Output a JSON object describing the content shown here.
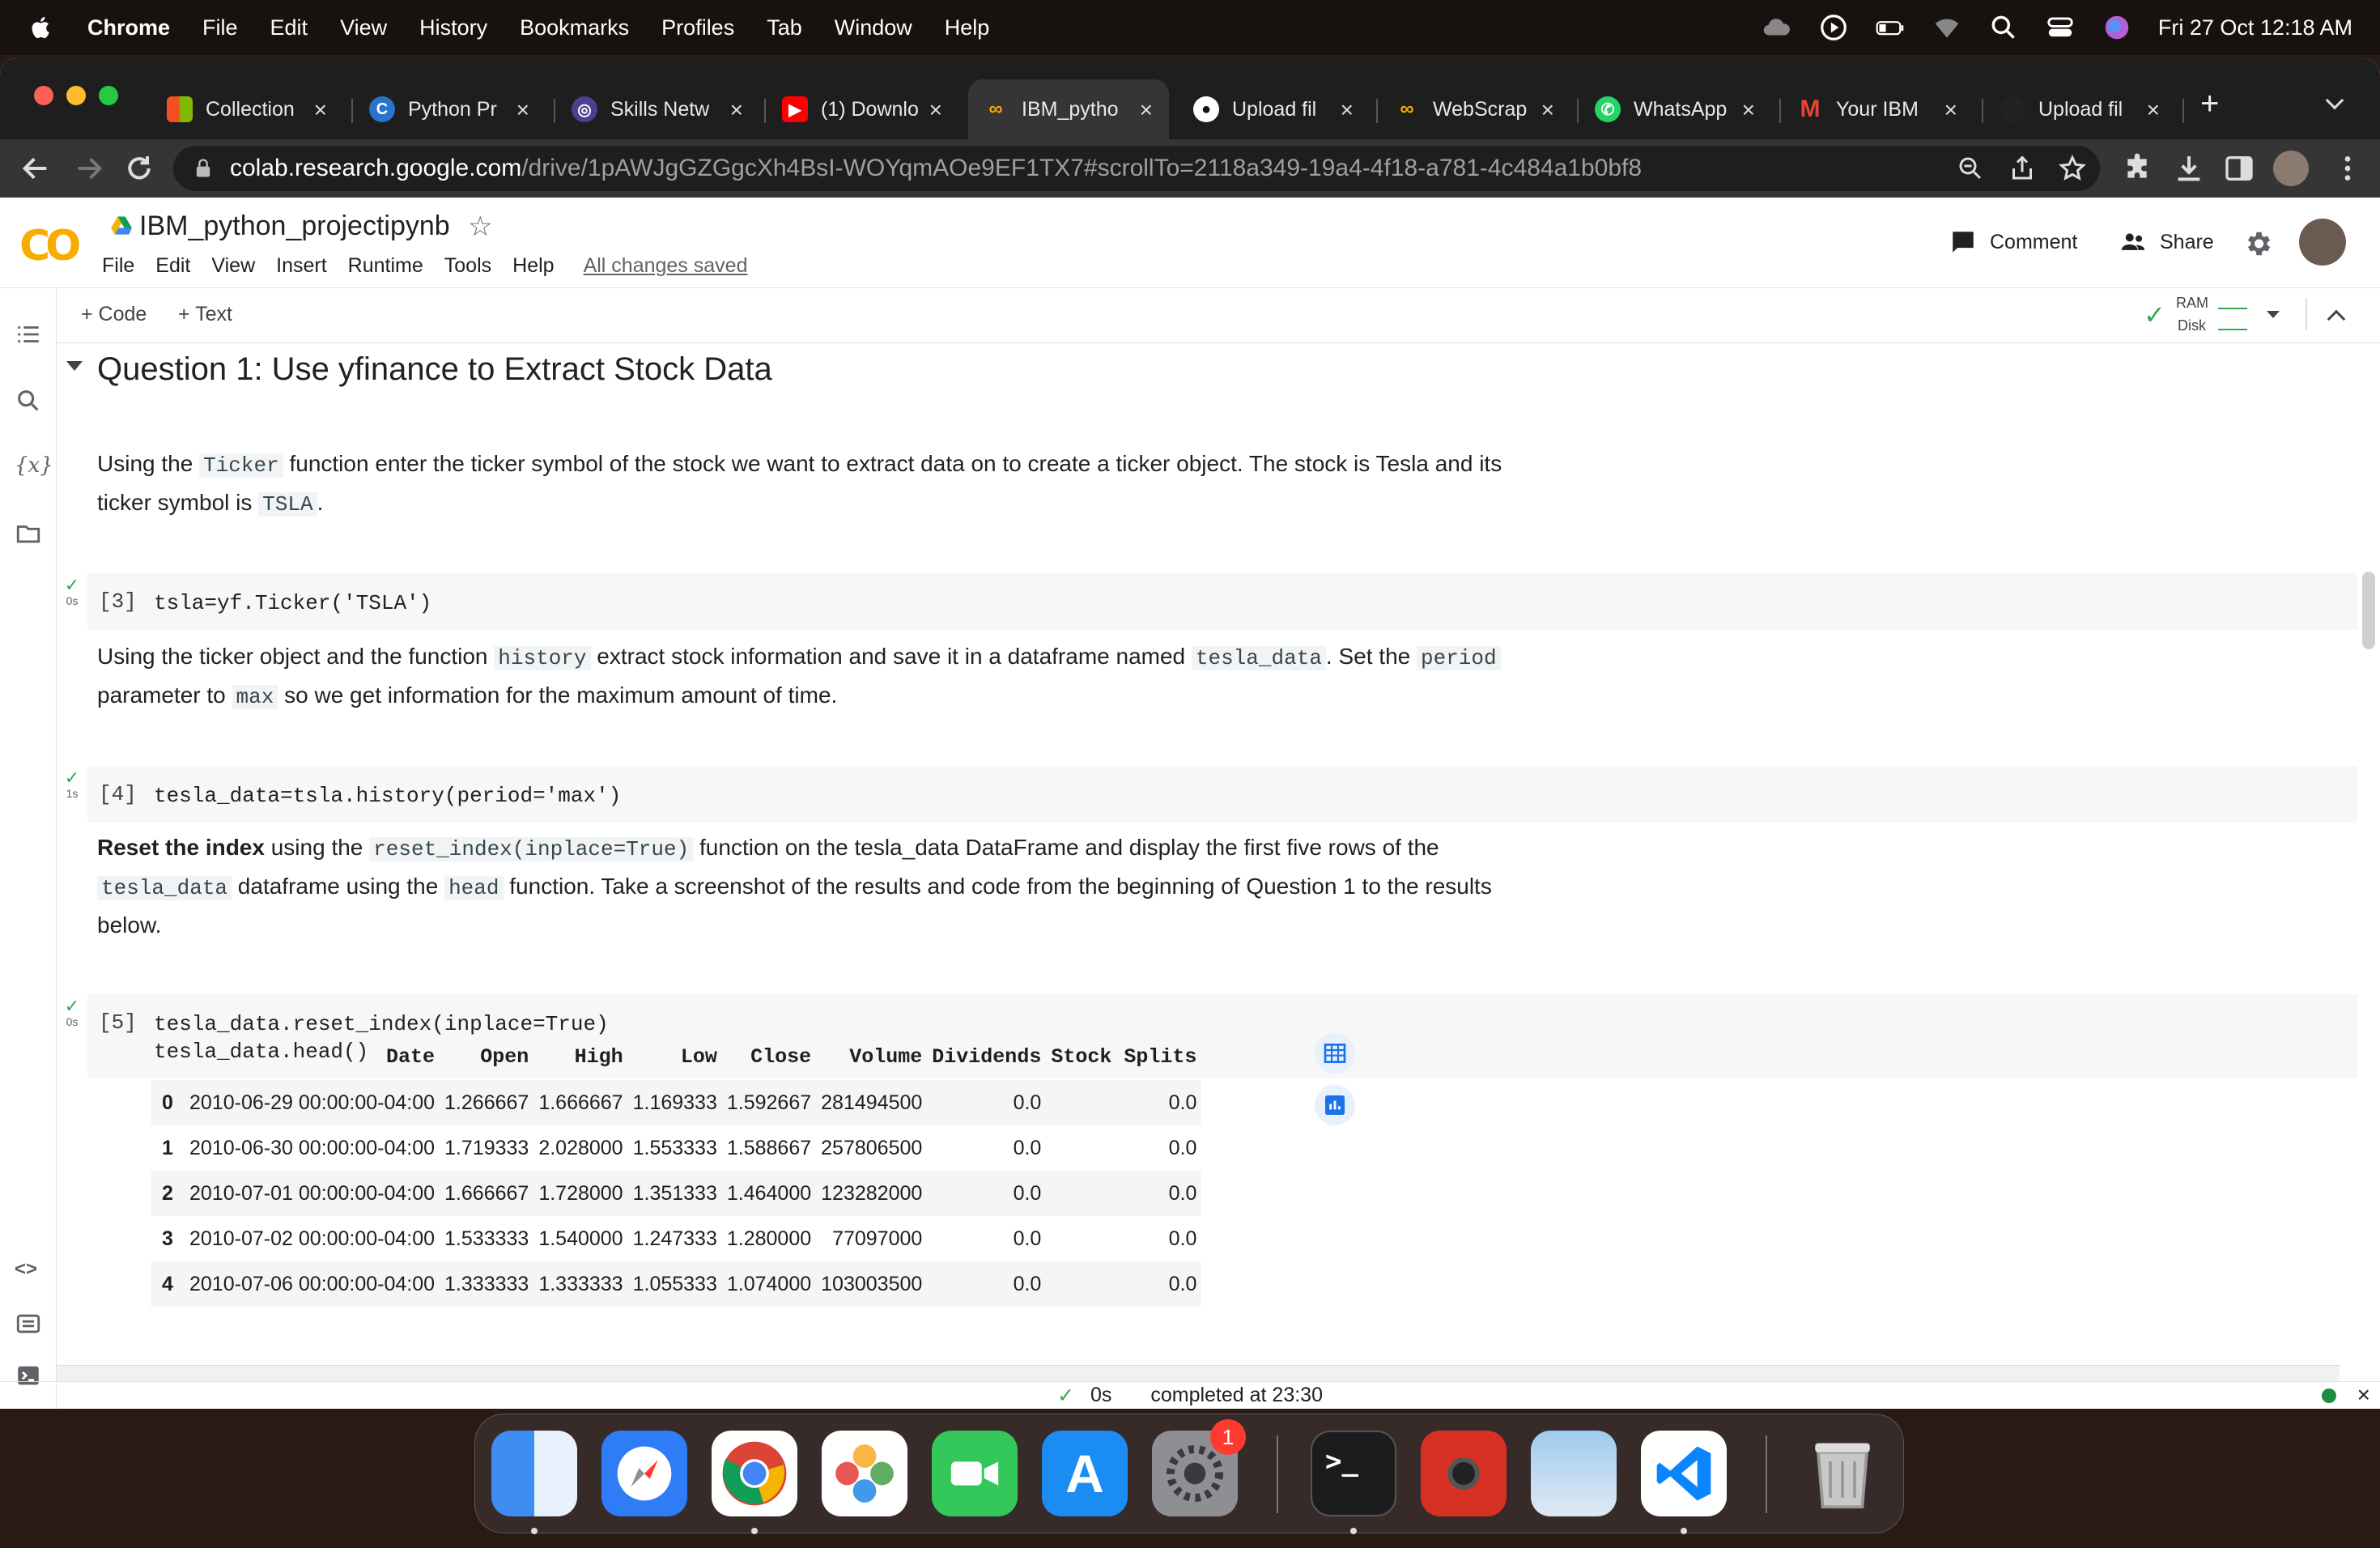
{
  "menubar": {
    "app": "Chrome",
    "items": [
      "File",
      "Edit",
      "View",
      "History",
      "Bookmarks",
      "Profiles",
      "Tab",
      "Window",
      "Help"
    ],
    "clock": "Fri 27 Oct  12:18 AM"
  },
  "browser": {
    "tabs": [
      {
        "label": "Collection",
        "icon": "grid-icon",
        "color": "#f25022"
      },
      {
        "label": "Python Pr",
        "icon": "coursera-icon",
        "color": "#2a73cc"
      },
      {
        "label": "Skills Netw",
        "icon": "skills-network-icon",
        "color": "#4b3f8f"
      },
      {
        "label": "(1) Downlo",
        "icon": "youtube-icon",
        "color": "#ff0000"
      },
      {
        "label": "IBM_pytho",
        "icon": "colab-icon",
        "color": "#f9ab00"
      },
      {
        "label": "Upload fil",
        "icon": "github-icon",
        "color": "#ffffff"
      },
      {
        "label": "WebScrap",
        "icon": "colab-icon",
        "color": "#f9ab00"
      },
      {
        "label": "WhatsApp",
        "icon": "whatsapp-icon",
        "color": "#25d366"
      },
      {
        "label": "Your IBM",
        "icon": "gmail-icon",
        "color": "#ea4335"
      },
      {
        "label": "Upload fil",
        "icon": "github-icon",
        "color": "#222222"
      }
    ],
    "url_host": "colab.research.google.com",
    "url_path": "/drive/1pAWJgGZGgcXh4BsI-WOYqmAOe9EF1TX7#scrollTo=2118a349-19a4-4f18-a781-4c484a1b0bf8"
  },
  "colab": {
    "title": "IBM_python_projectipynb",
    "menus": [
      "File",
      "Edit",
      "View",
      "Insert",
      "Runtime",
      "Tools",
      "Help"
    ],
    "saved_status": "All changes saved",
    "comment_label": "Comment",
    "share_label": "Share",
    "add_code": "+ Code",
    "add_text": "+ Text",
    "ram_label": "RAM",
    "disk_label": "Disk"
  },
  "notebook": {
    "section_title": "Question 1: Use yfinance to Extract Stock Data",
    "para1": {
      "t1": "Using the ",
      "c1": "Ticker",
      "t2": " function enter the ticker symbol of the stock we want to extract data on to create a ticker object. The stock is Tesla and its",
      "t3": "ticker symbol is ",
      "c2": "TSLA",
      "t4": "."
    },
    "cell3": {
      "prompt": "[3]",
      "code": "tsla=yf.Ticker('TSLA')",
      "time": "0s"
    },
    "para2": {
      "t1": "Using the ticker object and the function ",
      "c1": "history",
      "t2": " extract stock information and save it in a dataframe named ",
      "c2": "tesla_data",
      "t3": ". Set the ",
      "c3": "period",
      "t4": "parameter to ",
      "c4": "max",
      "t5": " so we get information for the maximum amount of time."
    },
    "cell4": {
      "prompt": "[4]",
      "code": "tesla_data=tsla.history(period='max')",
      "time": "1s"
    },
    "para3": {
      "b1": "Reset the index",
      "t1": " using the ",
      "c1": "reset_index(inplace=True)",
      "t2": " function on the tesla_data DataFrame and display the first five rows of the",
      "c2": "tesla_data",
      "t3": " dataframe using the ",
      "c3": "head",
      "t4": " function. Take a screenshot of the results and code from the beginning of Question 1 to the results",
      "t5": "below."
    },
    "cell5": {
      "prompt": "[5]",
      "line1": "tesla_data.reset_index(inplace=True)",
      "line2": "tesla_data.head()",
      "time": "0s"
    },
    "dataframe": {
      "columns": [
        "Date",
        "Open",
        "High",
        "Low",
        "Close",
        "Volume",
        "Dividends",
        "Stock Splits"
      ],
      "rows": [
        {
          "index": "0",
          "cells": [
            "2010-06-29 00:00:00-04:00",
            "1.266667",
            "1.666667",
            "1.169333",
            "1.592667",
            "281494500",
            "0.0",
            "0.0"
          ]
        },
        {
          "index": "1",
          "cells": [
            "2010-06-30 00:00:00-04:00",
            "1.719333",
            "2.028000",
            "1.553333",
            "1.588667",
            "257806500",
            "0.0",
            "0.0"
          ]
        },
        {
          "index": "2",
          "cells": [
            "2010-07-01 00:00:00-04:00",
            "1.666667",
            "1.728000",
            "1.351333",
            "1.464000",
            "123282000",
            "0.0",
            "0.0"
          ]
        },
        {
          "index": "3",
          "cells": [
            "2010-07-02 00:00:00-04:00",
            "1.533333",
            "1.540000",
            "1.247333",
            "1.280000",
            "77097000",
            "0.0",
            "0.0"
          ]
        },
        {
          "index": "4",
          "cells": [
            "2010-07-06 00:00:00-04:00",
            "1.333333",
            "1.333333",
            "1.055333",
            "1.074000",
            "103003500",
            "0.0",
            "0.0"
          ]
        }
      ]
    },
    "status": {
      "time": "0s",
      "text": "completed at 23:30"
    }
  },
  "dock": {
    "apps": [
      {
        "name": "finder-icon",
        "color": "#3d8ef0"
      },
      {
        "name": "safari-icon",
        "color": "#2f7df6"
      },
      {
        "name": "chrome-icon",
        "color": "#e8e8e8"
      },
      {
        "name": "photos-icon",
        "color": "#f5f5f5"
      },
      {
        "name": "facetime-icon",
        "color": "#34c759"
      },
      {
        "name": "app-store-icon",
        "color": "#1b8cf2"
      },
      {
        "name": "system-settings-icon",
        "color": "#8e8e93"
      },
      {
        "name": "terminal-icon",
        "color": "#1c1c1e"
      },
      {
        "name": "photo-booth-icon",
        "color": "#d93025"
      },
      {
        "name": "preview-icon",
        "color": "#6fa8dc"
      },
      {
        "name": "vscode-icon",
        "color": "#0a84ff"
      },
      {
        "name": "trash-icon",
        "color": "#b0b0b0"
      }
    ],
    "settings_badge": "1"
  }
}
